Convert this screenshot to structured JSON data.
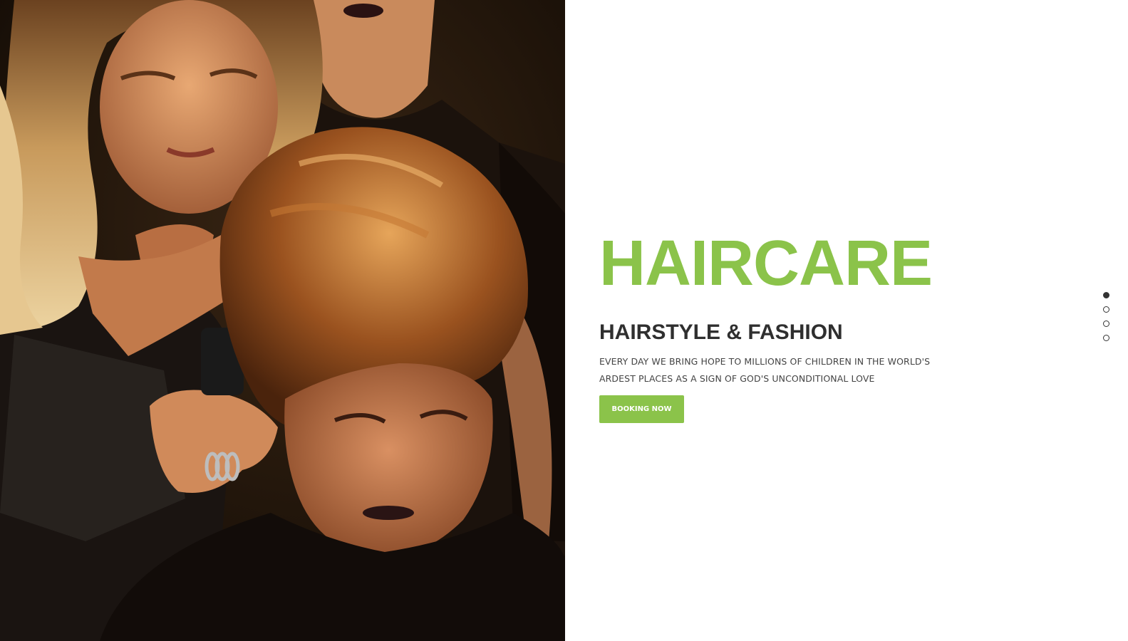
{
  "hero": {
    "title": "HAIRCARE",
    "subtitle": "HAIRSTYLE & FASHION",
    "description": "EVERY DAY WE BRING HOPE TO MILLIONS OF CHILDREN IN THE WORLD'S ARDEST PLACES AS A SIGN OF GOD'S UNCONDITIONAL LOVE",
    "button_label": "BOOKING NOW",
    "accent_color": "#8bc34a",
    "photo": "hairdresser-styling-client-photo"
  },
  "slider": {
    "dot_count": 4,
    "active_index": 0
  }
}
